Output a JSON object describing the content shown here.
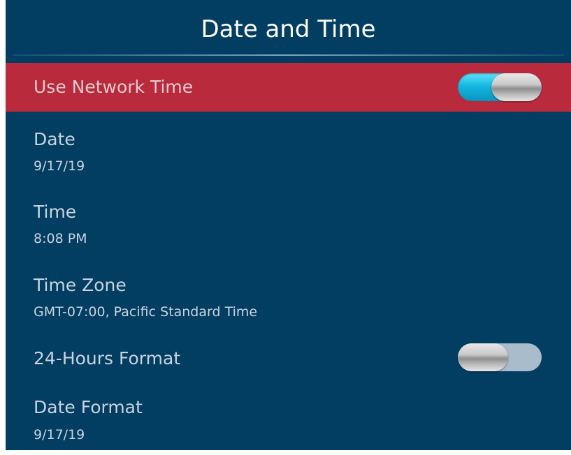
{
  "header": {
    "title": "Date and Time"
  },
  "settings": {
    "use_network_time": {
      "label": "Use Network Time",
      "enabled": true
    },
    "date": {
      "label": "Date",
      "value": "9/17/19"
    },
    "time": {
      "label": "Time",
      "value": "8:08 PM"
    },
    "time_zone": {
      "label": "Time Zone",
      "value": "GMT-07:00, Pacific Standard Time"
    },
    "hours_format": {
      "label": "24-Hours Format",
      "enabled": false
    },
    "date_format": {
      "label": "Date Format",
      "value": "9/17/19"
    }
  },
  "colors": {
    "background": "#023d62",
    "highlight_row": "#b82a3c",
    "toggle_on": "#14b7e0",
    "toggle_off": "#a8bccc",
    "title_text": "#ffffff",
    "body_text": "#c9d3dd"
  }
}
